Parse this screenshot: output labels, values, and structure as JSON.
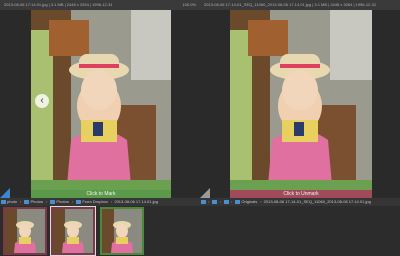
{
  "left_pane": {
    "status": "2013-08-06 17:14:01.jpg  |  3.1 MB  |  2448 x 3264  |  1996-12-31",
    "zoom": "100.0%",
    "mark_label": "Click to Mark"
  },
  "right_pane": {
    "status": "2013-08-06 17-14-01_SEQ_11060_2013-08-06 17.14.01.jpg  |  3.1 MB  |  2448 x 3264  |  1996-12-31",
    "mark_label": "Click to Unmark"
  },
  "left_path": {
    "items": [
      "photo",
      "Photos",
      "Photos",
      "From Dropbox",
      "2013-08-06 17.14.01.jpg"
    ]
  },
  "right_path": {
    "items": [
      "Originals",
      "2013-08-06 17-14-01_SEQ_11060_2013-08-06 17.14.01.jpg"
    ]
  },
  "colors": {
    "mark_green": "#5a9a4a",
    "unmark_red": "#a04a5a",
    "folder_blue": "#4a90d0"
  },
  "icons": {
    "prev": "chevron-left-icon",
    "folder": "folder-icon"
  }
}
